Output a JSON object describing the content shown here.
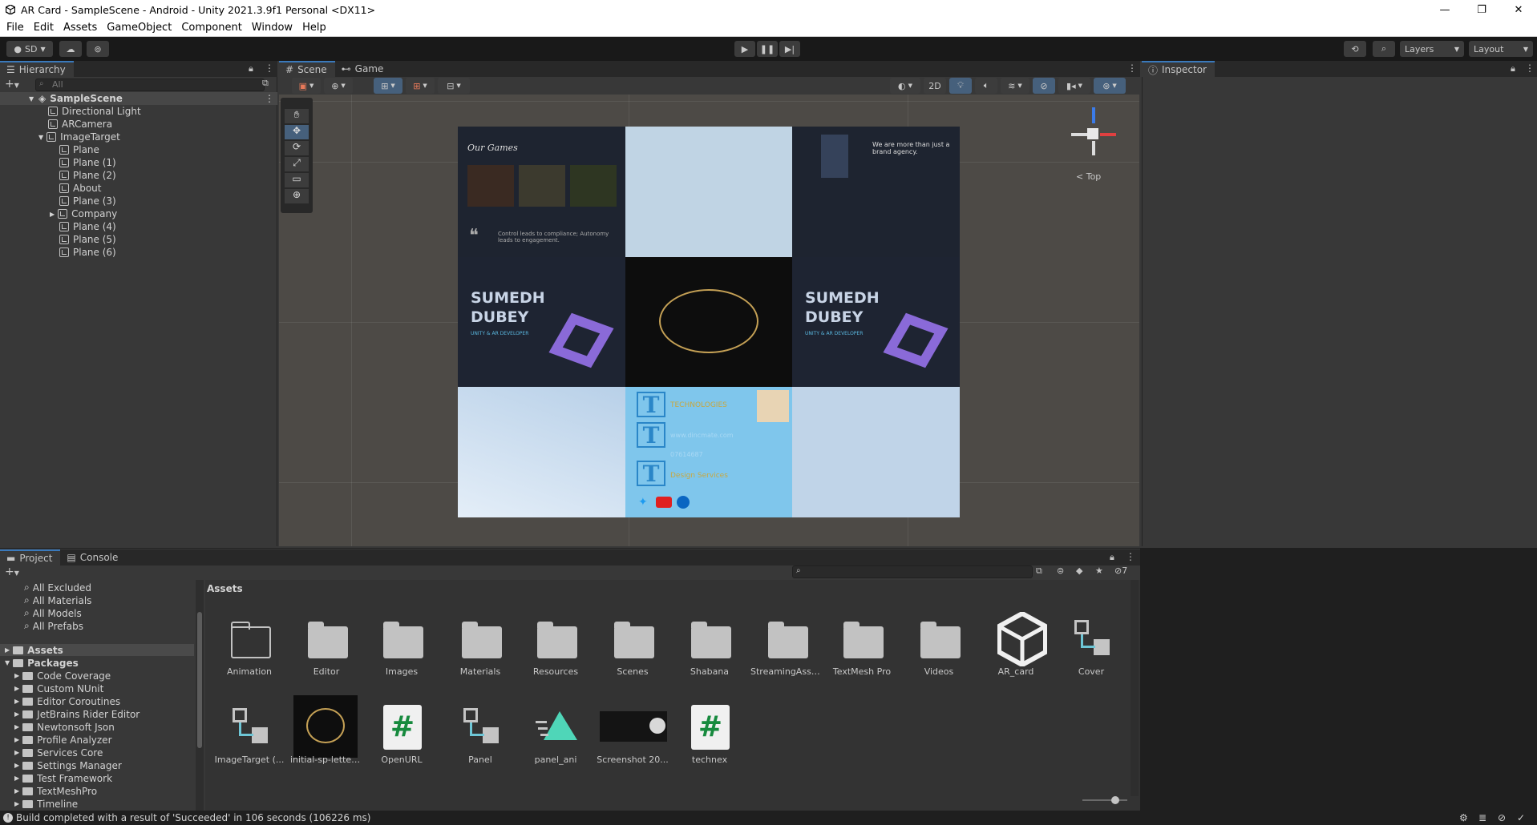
{
  "window": {
    "title": "AR Card - SampleScene - Android - Unity 2021.3.9f1 Personal <DX11>",
    "controls": [
      "—",
      "❐",
      "✕"
    ]
  },
  "menu": [
    "File",
    "Edit",
    "Assets",
    "GameObject",
    "Component",
    "Window",
    "Help"
  ],
  "toolbar": {
    "account": "SD",
    "layers": "Layers",
    "layout": "Layout"
  },
  "hierarchy": {
    "tab": "Hierarchy",
    "search_placeholder": "All",
    "scene": "SampleScene",
    "items": [
      {
        "label": "Directional Light"
      },
      {
        "label": "ARCamera"
      },
      {
        "label": "ImageTarget"
      },
      {
        "label": "Plane"
      },
      {
        "label": "Plane (1)"
      },
      {
        "label": "Plane (2)"
      },
      {
        "label": "About"
      },
      {
        "label": "Plane (3)"
      },
      {
        "label": "Company"
      },
      {
        "label": "Plane (4)"
      },
      {
        "label": "Plane (5)"
      },
      {
        "label": "Plane (6)"
      }
    ]
  },
  "scene": {
    "tabs": [
      "Scene",
      "Game"
    ],
    "mode_2d": "2D",
    "gizmo_label": "< Top",
    "card": {
      "games_title": "Our Games",
      "games_quote": "Control leads to compliance; Autonomy leads to engagement.",
      "agency_text": "We are more than just a brand agency.",
      "name_line1": "SUMEDH",
      "name_line2": "DUBEY",
      "role": "UNITY & AR DEVELOPER",
      "company_text": "TECHNOLOGIES",
      "url_text": "www.dincmate.com",
      "phone_text": "07614687",
      "services_text": "Design Services"
    }
  },
  "inspector": {
    "tab": "Inspector"
  },
  "project": {
    "tabs": [
      "Project",
      "Console"
    ],
    "favorites": [
      "All Excluded",
      "All Materials",
      "All Models",
      "All Prefabs"
    ],
    "assets_root": "Assets",
    "packages_root": "Packages",
    "packages": [
      "Code Coverage",
      "Custom NUnit",
      "Editor Coroutines",
      "JetBrains Rider Editor",
      "Newtonsoft Json",
      "Profile Analyzer",
      "Services Core",
      "Settings Manager",
      "Test Framework",
      "TextMeshPro",
      "Timeline"
    ],
    "breadcrumb": "Assets",
    "hidden_count": "7",
    "assets": [
      {
        "label": "Animation",
        "kind": "folder-outline"
      },
      {
        "label": "Editor",
        "kind": "folder"
      },
      {
        "label": "Images",
        "kind": "folder"
      },
      {
        "label": "Materials",
        "kind": "folder"
      },
      {
        "label": "Resources",
        "kind": "folder"
      },
      {
        "label": "Scenes",
        "kind": "folder"
      },
      {
        "label": "Shabana",
        "kind": "folder"
      },
      {
        "label": "StreamingAsse...",
        "kind": "folder"
      },
      {
        "label": "TextMesh Pro",
        "kind": "folder"
      },
      {
        "label": "Videos",
        "kind": "folder"
      },
      {
        "label": "AR_card",
        "kind": "unity"
      },
      {
        "label": "Cover",
        "kind": "prefab"
      },
      {
        "label": "ImageTarget (...",
        "kind": "prefab"
      },
      {
        "label": "initial-sp-letter...",
        "kind": "image"
      },
      {
        "label": "OpenURL",
        "kind": "script"
      },
      {
        "label": "Panel",
        "kind": "prefab"
      },
      {
        "label": "panel_ani",
        "kind": "anim"
      },
      {
        "label": "Screenshot 20...",
        "kind": "screenshot"
      },
      {
        "label": "technex",
        "kind": "script"
      }
    ]
  },
  "status": {
    "message": "Build completed with a result of 'Succeeded' in 106 seconds (106226 ms)"
  }
}
